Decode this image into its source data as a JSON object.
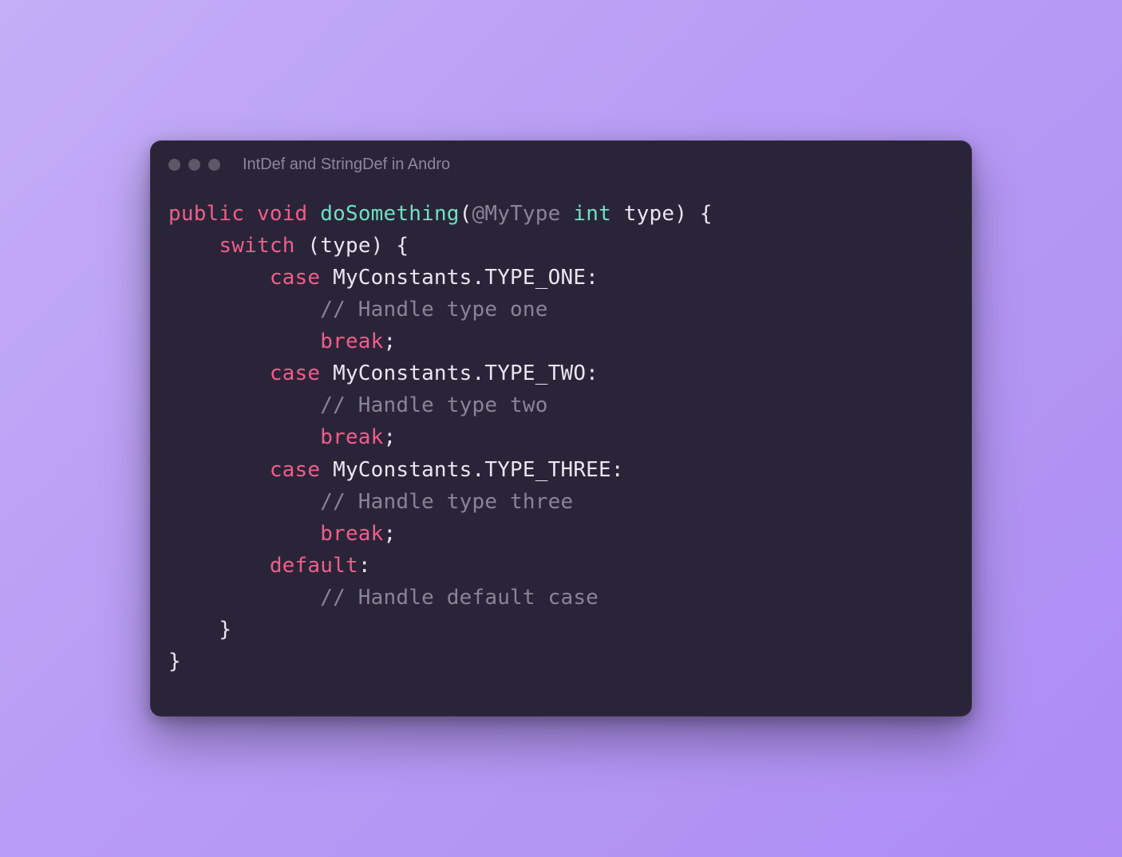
{
  "window": {
    "title": "IntDef and StringDef in Andro"
  },
  "code": {
    "kw_public": "public",
    "kw_void": "void",
    "fn_name": "doSomething",
    "paren_open": "(",
    "annotation": "@MyType",
    "kw_int": "int",
    "param_name": "type",
    "paren_close_brace": ") {",
    "indent1": "    ",
    "kw_switch": "switch",
    "switch_paren": " (type) {",
    "indent2": "        ",
    "kw_case": "case",
    "case1_value": " MyConstants.TYPE_ONE:",
    "indent3": "            ",
    "comment1": "// Handle type one",
    "kw_break": "break",
    "semi": ";",
    "case2_value": " MyConstants.TYPE_TWO:",
    "comment2": "// Handle type two",
    "case3_value": " MyConstants.TYPE_THREE:",
    "comment3": "// Handle type three",
    "kw_default": "default",
    "colon": ":",
    "comment4": "// Handle default case",
    "close_brace1": "    }",
    "close_brace0": "}"
  }
}
